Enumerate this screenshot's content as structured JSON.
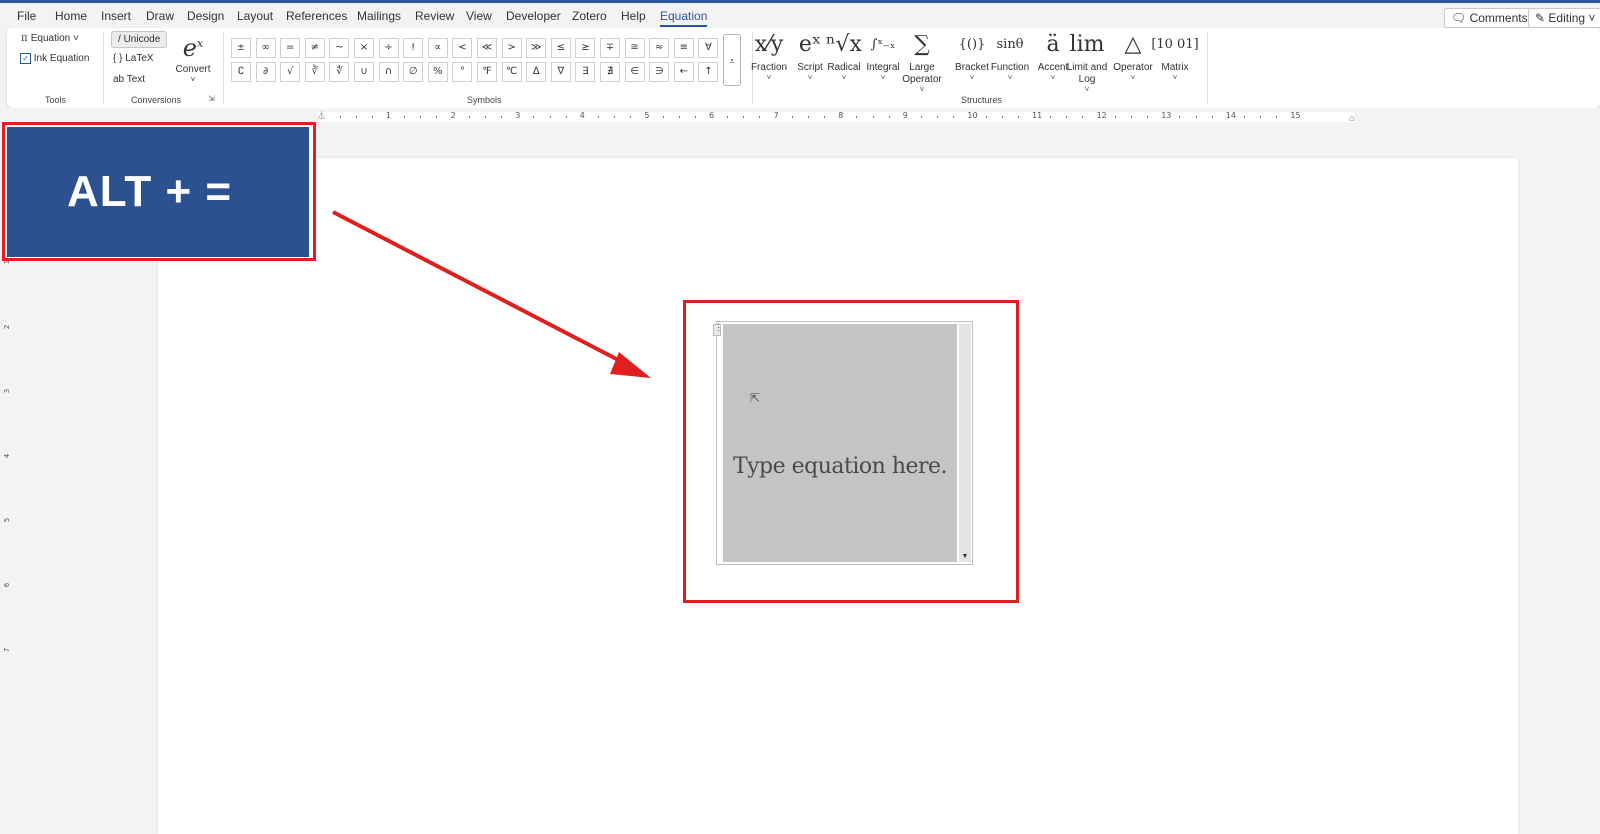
{
  "menu": {
    "items": [
      "File",
      "Home",
      "Insert",
      "Draw",
      "Design",
      "Layout",
      "References",
      "Mailings",
      "Review",
      "View",
      "Developer",
      "Zotero",
      "Help",
      "Equation"
    ],
    "active": "Equation",
    "comments_label": "Comments",
    "editing_label": "Editing"
  },
  "ribbon": {
    "tools": {
      "equation_label": "Equation",
      "ink_equation_label": "Ink Equation",
      "group_label": "Tools"
    },
    "conversions": {
      "unicode_label": "Unicode",
      "latex_label": "LaTeX",
      "text_label": "Text",
      "convert_label": "Convert",
      "group_label": "Conversions"
    },
    "symbols": {
      "row1": [
        "±",
        "∞",
        "=",
        "≠",
        "~",
        "×",
        "÷",
        "!",
        "∝",
        "<",
        "≪",
        ">",
        "≫",
        "≤",
        "≥",
        "∓",
        "≅",
        "≈",
        "≡",
        "∀"
      ],
      "row2": [
        "∁",
        "∂",
        "√",
        "∛",
        "∜",
        "∪",
        "∩",
        "∅",
        "%",
        "°",
        "℉",
        "℃",
        "∆",
        "∇",
        "∃",
        "∄",
        "∈",
        "∋",
        "←",
        "↑"
      ],
      "group_label": "Symbols"
    },
    "structures": {
      "items": [
        {
          "glyph": "x⁄y",
          "label": "Fraction"
        },
        {
          "glyph": "eˣ",
          "label": "Script"
        },
        {
          "glyph": "ⁿ√x",
          "label": "Radical"
        },
        {
          "glyph": "∫ˣ₋ₓ",
          "label": "Integral"
        },
        {
          "glyph": "∑",
          "label": "Large\nOperator"
        },
        {
          "glyph": "{()}",
          "label": "Bracket"
        },
        {
          "glyph": "sinθ",
          "label": "Function"
        },
        {
          "glyph": "ä",
          "label": "Accent"
        },
        {
          "glyph": "lim",
          "label": "Limit and\nLog"
        },
        {
          "glyph": "△",
          "label": "Operator"
        },
        {
          "glyph": "[10 01]",
          "label": "Matrix"
        }
      ],
      "group_label": "Structures"
    }
  },
  "ruler": {
    "numbers": [
      "1",
      "2",
      "3",
      "4",
      "5",
      "6",
      "7",
      "8",
      "9",
      "10",
      "11",
      "12",
      "13",
      "14",
      "15"
    ],
    "vertical_numbers": [
      "1",
      "2",
      "3",
      "4",
      "5",
      "6",
      "7"
    ]
  },
  "callout": {
    "text": "ALT + ="
  },
  "equation": {
    "placeholder": "Type equation here."
  },
  "colors": {
    "accent": "#2b579a",
    "callout_bg": "#2b5191",
    "highlight": "#e02020",
    "equation_fill": "#c4c4c4"
  }
}
